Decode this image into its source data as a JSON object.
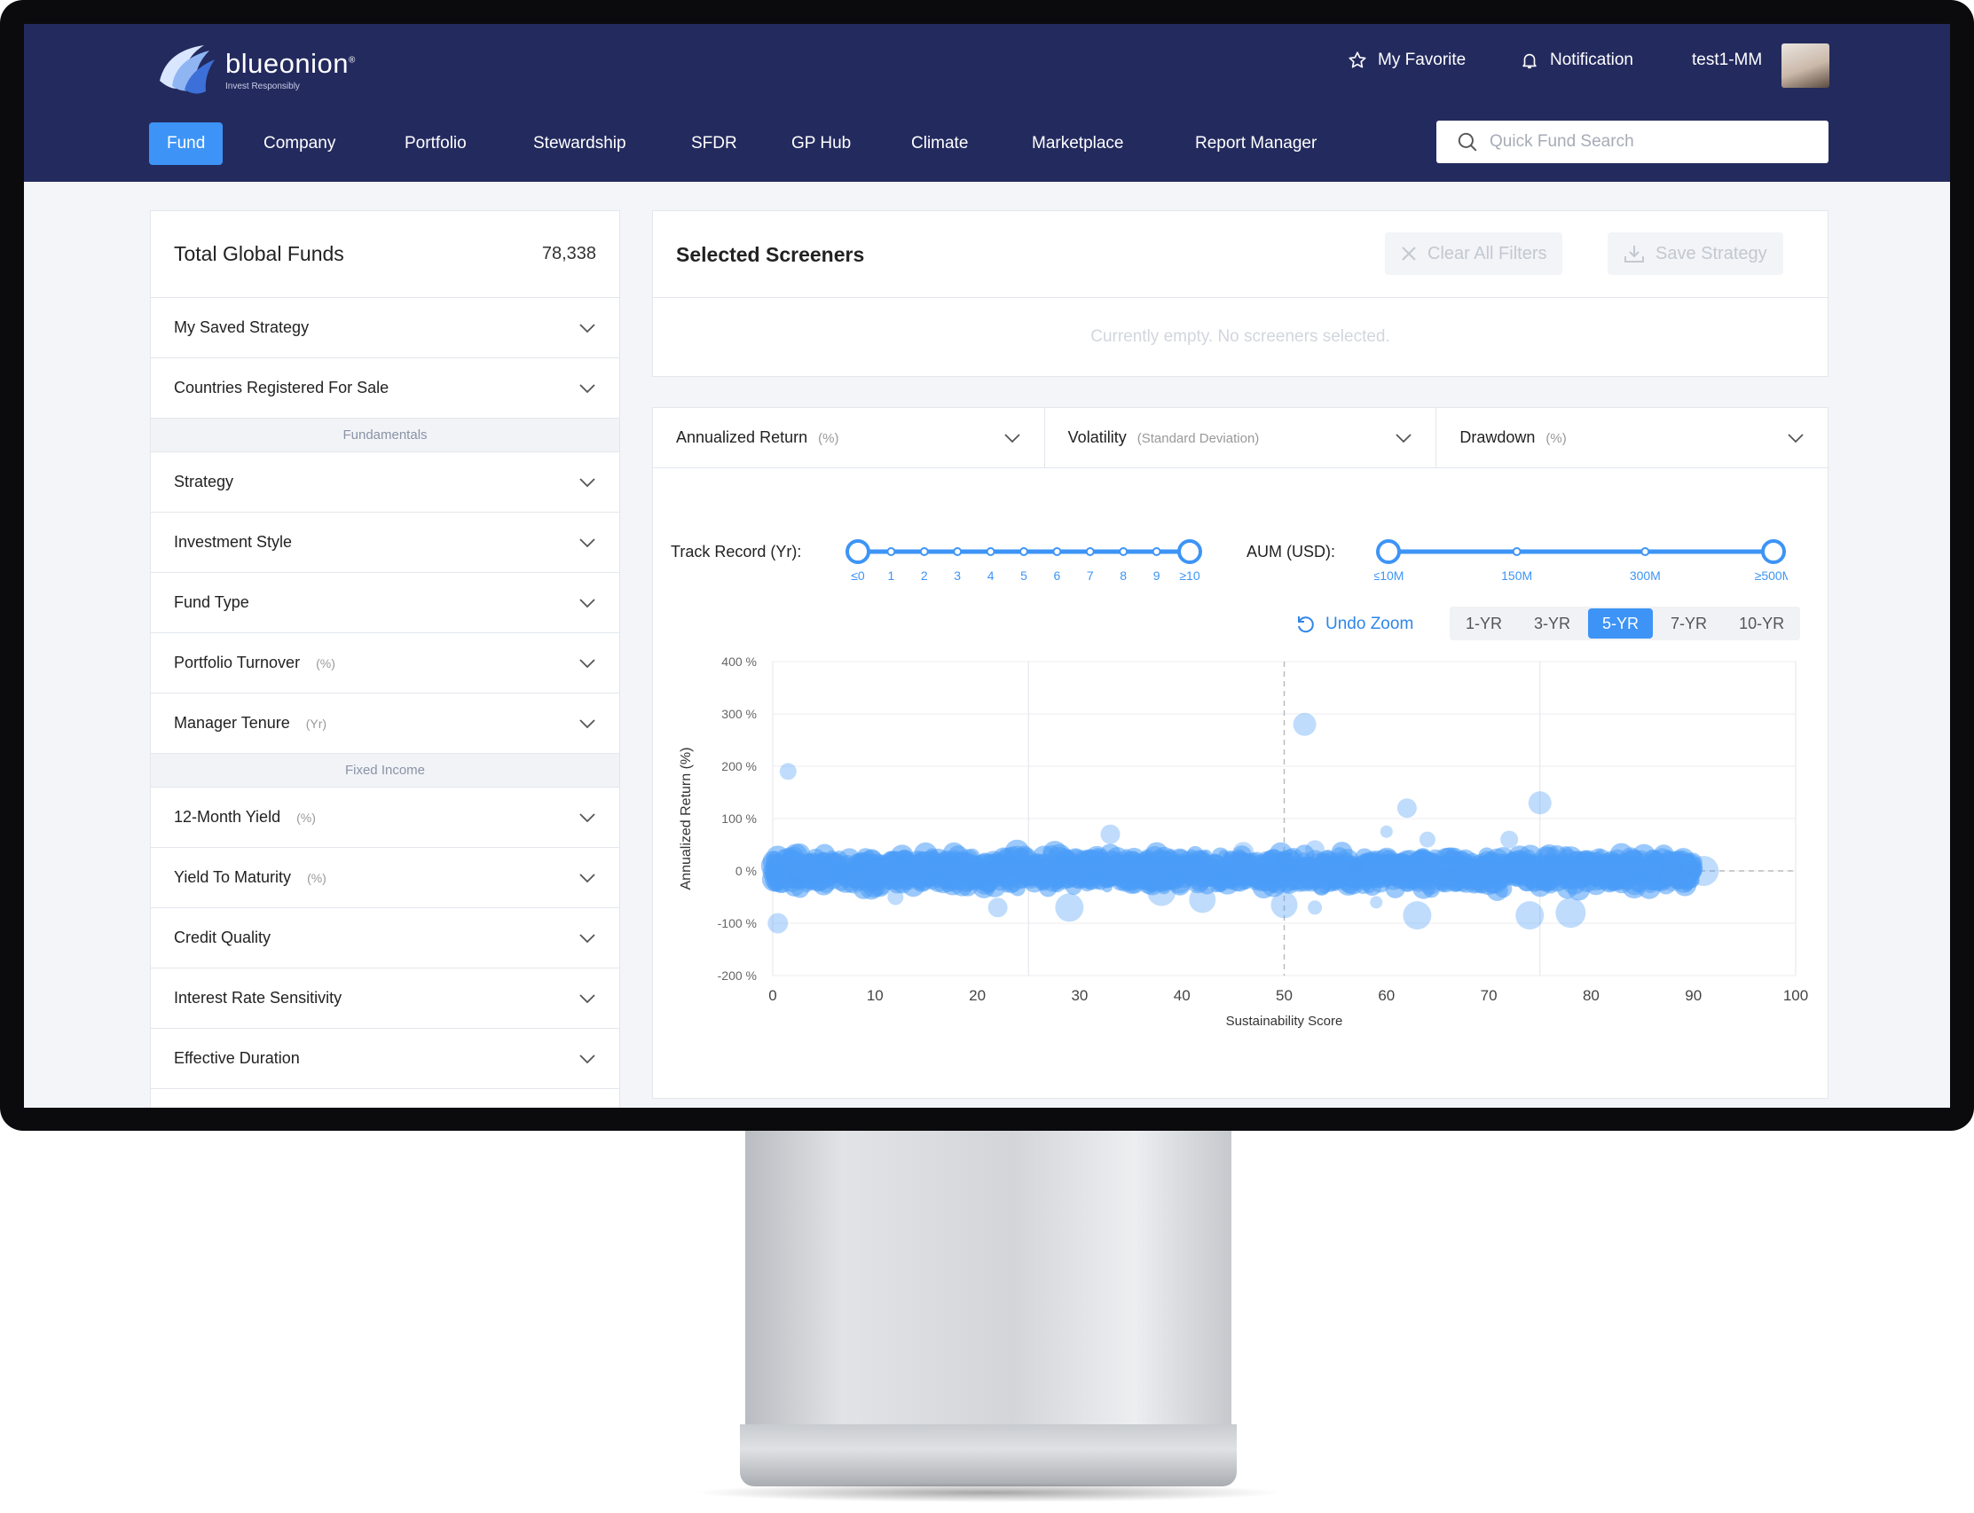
{
  "app": {
    "logo_name": "blueonion",
    "logo_reg": "®",
    "logo_tagline": "Invest Responsibly"
  },
  "header": {
    "favorite_label": "My Favorite",
    "notification_label": "Notification",
    "user_name": "test1-MM",
    "search_placeholder": "Quick Fund Search"
  },
  "nav": [
    "Fund",
    "Company",
    "Portfolio",
    "Stewardship",
    "SFDR",
    "GP Hub",
    "Climate",
    "Marketplace",
    "Report Manager"
  ],
  "left_panel": {
    "title": "Total Global Funds",
    "count": "78,338",
    "saved_strategy": "My Saved Strategy",
    "countries": "Countries Registered For Sale",
    "fundamentals_label": "Fundamentals",
    "strategy": "Strategy",
    "investment_style": "Investment Style",
    "fund_type": "Fund Type",
    "portfolio_turnover": "Portfolio Turnover",
    "portfolio_turnover_unit": "(%)",
    "manager_tenure": "Manager Tenure",
    "manager_tenure_unit": "(Yr)",
    "fixed_income_label": "Fixed Income",
    "yield_12m": "12-Month Yield",
    "yield_12m_unit": "(%)",
    "ytm": "Yield To Maturity",
    "ytm_unit": "(%)",
    "credit_quality": "Credit Quality",
    "rate_sensitivity": "Interest Rate Sensitivity",
    "effective_duration": "Effective Duration"
  },
  "screeners": {
    "title": "Selected Screeners",
    "clear_label": "Clear All Filters",
    "save_label": "Save Strategy",
    "empty_text": "Currently empty. No screeners selected."
  },
  "metrics": {
    "annualized_return": "Annualized Return",
    "annualized_return_unit": "(%)",
    "volatility": "Volatility",
    "volatility_unit": "(Standard Deviation)",
    "drawdown": "Drawdown",
    "drawdown_unit": "(%)"
  },
  "filters": {
    "track_record_label": "Track Record (Yr):",
    "track_record_ticks": [
      "≤0",
      "1",
      "2",
      "3",
      "4",
      "5",
      "6",
      "7",
      "8",
      "9",
      "≥10"
    ],
    "aum_label": "AUM (USD):",
    "aum_ticks": [
      "≤10M",
      "150M",
      "300M",
      "≥500M"
    ]
  },
  "chart_controls": {
    "undo_zoom": "Undo Zoom",
    "periods": [
      "1-YR",
      "3-YR",
      "5-YR",
      "7-YR",
      "10-YR"
    ],
    "active_period": "5-YR"
  },
  "colors": {
    "nav_bg": "#232a5e",
    "accent": "#3d94f6",
    "point": "#4a9cf7"
  },
  "chart_data": {
    "type": "scatter",
    "title": "",
    "xlabel": "Sustainability Score",
    "ylabel": "Annualized Return (%)",
    "xlim": [
      0,
      100
    ],
    "ylim": [
      -200,
      400
    ],
    "x_ticks": [
      "0",
      "10",
      "20",
      "30",
      "40",
      "50",
      "60",
      "70",
      "80",
      "90",
      "100"
    ],
    "y_ticks": [
      "400 %",
      "300 %",
      "200 %",
      "100 %",
      "0 %",
      "-100 %",
      "-200 %"
    ],
    "reference_lines": {
      "x": 50,
      "y": 0
    },
    "grid": true,
    "dense_band": {
      "x_range": [
        0,
        90
      ],
      "y_range": [
        -40,
        40
      ]
    },
    "points": [
      [
        1.5,
        190
      ],
      [
        52,
        280
      ],
      [
        33,
        70
      ],
      [
        62,
        120
      ],
      [
        75,
        130
      ],
      [
        60,
        75
      ],
      [
        64,
        60
      ],
      [
        72,
        60
      ],
      [
        50,
        25
      ],
      [
        53,
        40
      ],
      [
        46,
        35
      ],
      [
        57,
        10
      ],
      [
        91,
        0
      ],
      [
        2,
        -20
      ],
      [
        12,
        -50
      ],
      [
        22,
        -70
      ],
      [
        29,
        -70
      ],
      [
        59,
        -60
      ],
      [
        63,
        -85
      ],
      [
        74,
        -85
      ],
      [
        78,
        -80
      ],
      [
        0.5,
        -100
      ],
      [
        53,
        -70
      ],
      [
        42,
        -55
      ],
      [
        88,
        -10
      ],
      [
        66,
        -15
      ],
      [
        38,
        -40
      ],
      [
        8,
        -25
      ],
      [
        50,
        -65
      ]
    ]
  }
}
